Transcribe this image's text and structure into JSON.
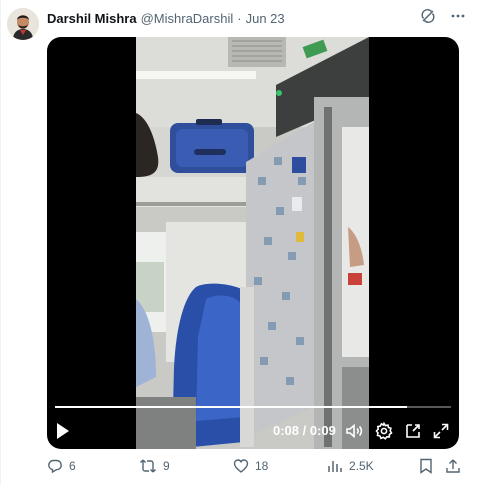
{
  "tweet": {
    "display_name": "Darshil Mishra",
    "handle": "@MishraDarshil",
    "separator": "·",
    "date": "Jun 23"
  },
  "top_icons": [
    "grok-icon",
    "more-icon"
  ],
  "video": {
    "current_time": "0:08",
    "time_separator": "/",
    "duration": "0:09",
    "time_display": "0:08 / 0:09",
    "progress": 0.89,
    "controls": [
      "play-icon",
      "volume-icon",
      "settings-icon",
      "pip-icon",
      "fullscreen-icon"
    ]
  },
  "actions": {
    "replies": "6",
    "reposts": "9",
    "likes": "18",
    "views": "2.5K"
  },
  "colors": {
    "text_secondary": "#536471",
    "text_primary": "#0f1419",
    "seat_blue": "#2a4fa8"
  }
}
